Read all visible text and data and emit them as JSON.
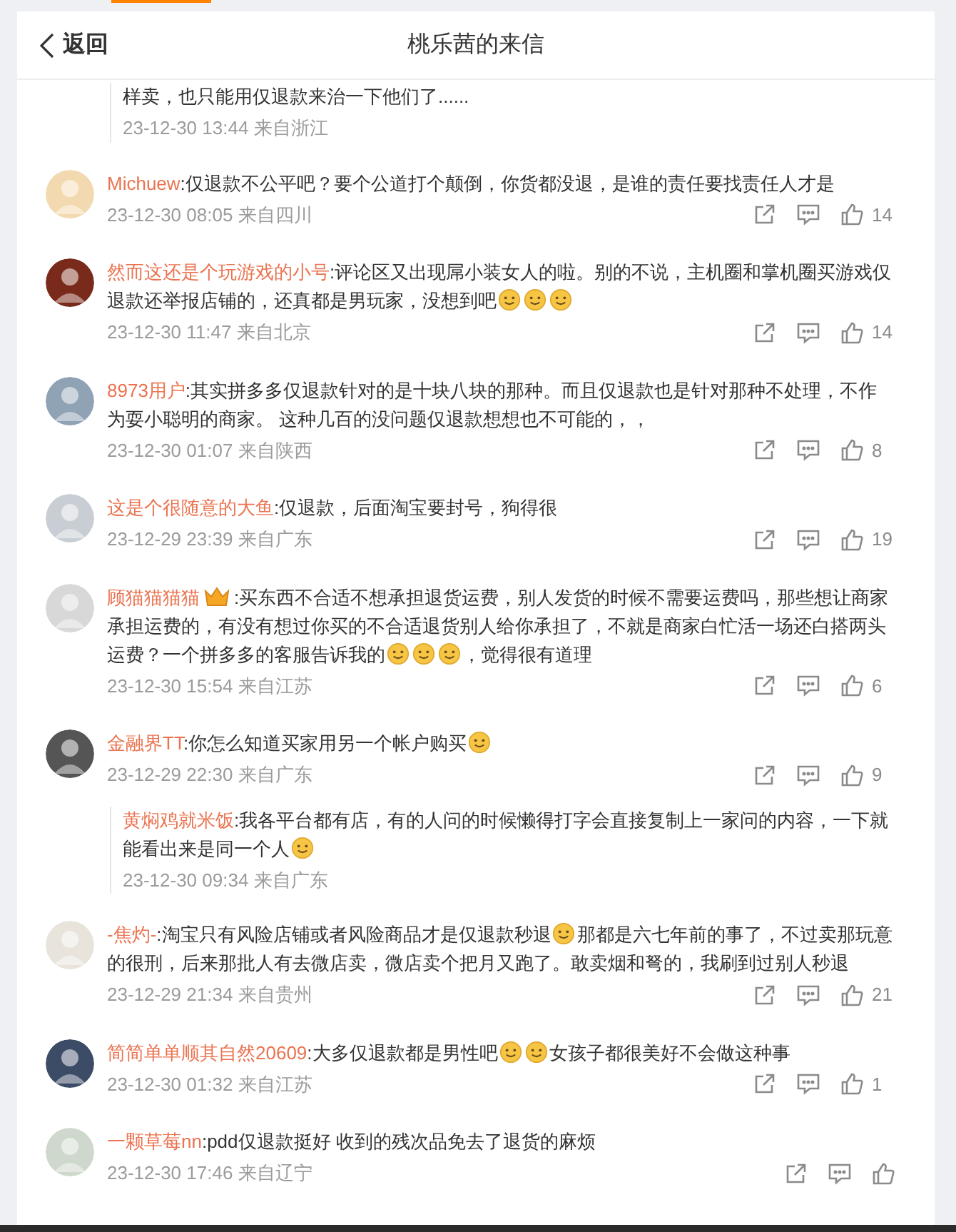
{
  "header": {
    "back": "返回",
    "title": "桃乐茜的来信"
  },
  "items": [
    {
      "kind": "reply",
      "segments": [
        {
          "kind": "text",
          "text": "样卖，也只能用仅退款来治一下他们了......"
        }
      ],
      "time": "23-12-30 13:44 来自浙江"
    },
    {
      "kind": "comment",
      "name": "Michuew",
      "vip": false,
      "segments": [
        {
          "kind": "text",
          "text": ":仅退款不公平吧？要个公道打个颠倒，你货都没退，是谁的责任要找责任人才是"
        }
      ],
      "time": "23-12-30 08:05 来自四川",
      "likes": "14"
    },
    {
      "kind": "comment",
      "name": "然而这还是个玩游戏的小号",
      "vip": false,
      "segments": [
        {
          "kind": "text",
          "text": ":评论区又出现屌小装女人的啦。别的不说，主机圈和掌机圈买游戏仅退款还举报店铺的，还真都是男玩家，没想到吧"
        },
        {
          "kind": "emoji"
        },
        {
          "kind": "emoji"
        },
        {
          "kind": "emoji"
        }
      ],
      "time": "23-12-30 11:47 来自北京",
      "likes": "14"
    },
    {
      "kind": "comment",
      "name": "8973用户",
      "vip": false,
      "segments": [
        {
          "kind": "text",
          "text": ":其实拼多多仅退款针对的是十块八块的那种。而且仅退款也是针对那种不处理，不作为耍小聪明的商家。 这种几百的没问题仅退款想想也不可能的，，"
        }
      ],
      "time": "23-12-30 01:07 来自陕西",
      "likes": "8"
    },
    {
      "kind": "comment",
      "name": "这是个很随意的大鱼",
      "vip": false,
      "segments": [
        {
          "kind": "text",
          "text": ":仅退款，后面淘宝要封号，狗得很"
        }
      ],
      "time": "23-12-29 23:39 来自广东",
      "likes": "19"
    },
    {
      "kind": "comment",
      "name": "顾猫猫猫猫",
      "vip": true,
      "segments": [
        {
          "kind": "text",
          "text": ":买东西不合适不想承担退货运费，别人发货的时候不需要运费吗，那些想让商家承担运费的，有没有想过你买的不合适退货别人给你承担了，不就是商家白忙活一场还白搭两头运费？一个拼多多的客服告诉我的"
        },
        {
          "kind": "emoji"
        },
        {
          "kind": "emoji"
        },
        {
          "kind": "emoji"
        },
        {
          "kind": "text",
          "text": "，觉得很有道理"
        }
      ],
      "time": "23-12-30 15:54 来自江苏",
      "likes": "6"
    },
    {
      "kind": "comment",
      "name": "金融界TT",
      "vip": false,
      "segments": [
        {
          "kind": "text",
          "text": ":你怎么知道买家用另一个帐户购买"
        },
        {
          "kind": "emoji"
        }
      ],
      "time": "23-12-29 22:30 来自广东",
      "likes": "9"
    },
    {
      "kind": "reply",
      "name": "黄焖鸡就米饭",
      "segments": [
        {
          "kind": "text",
          "text": ":我各平台都有店，有的人问的时候懒得打字会直接复制上一家问的内容，一下就能看出来是同一个人"
        },
        {
          "kind": "emoji"
        }
      ],
      "time": "23-12-30 09:34 来自广东"
    },
    {
      "kind": "comment",
      "name": "-焦灼-",
      "vip": false,
      "segments": [
        {
          "kind": "text",
          "text": ":淘宝只有风险店铺或者风险商品才是仅退款秒退"
        },
        {
          "kind": "emoji"
        },
        {
          "kind": "text",
          "text": "那都是六七年前的事了，不过卖那玩意的很刑，后来那批人有去微店卖，微店卖个把月又跑了。敢卖烟和弩的，我刷到过别人秒退"
        }
      ],
      "time": "23-12-29 21:34 来自贵州",
      "likes": "21"
    },
    {
      "kind": "comment",
      "name": "简简单单顺其自然20609",
      "vip": false,
      "segments": [
        {
          "kind": "text",
          "text": ":大多仅退款都是男性吧"
        },
        {
          "kind": "emoji"
        },
        {
          "kind": "emoji"
        },
        {
          "kind": "text",
          "text": "女孩子都很美好不会做这种事"
        }
      ],
      "time": "23-12-30 01:32 来自江苏",
      "likes": "1"
    },
    {
      "kind": "comment",
      "name": "一颗草莓nn",
      "vip": false,
      "segments": [
        {
          "kind": "text",
          "text": ":pdd仅退款挺好 收到的残次品免去了退货的麻烦"
        }
      ],
      "time": "23-12-30 17:46 来自辽宁"
    }
  ]
}
